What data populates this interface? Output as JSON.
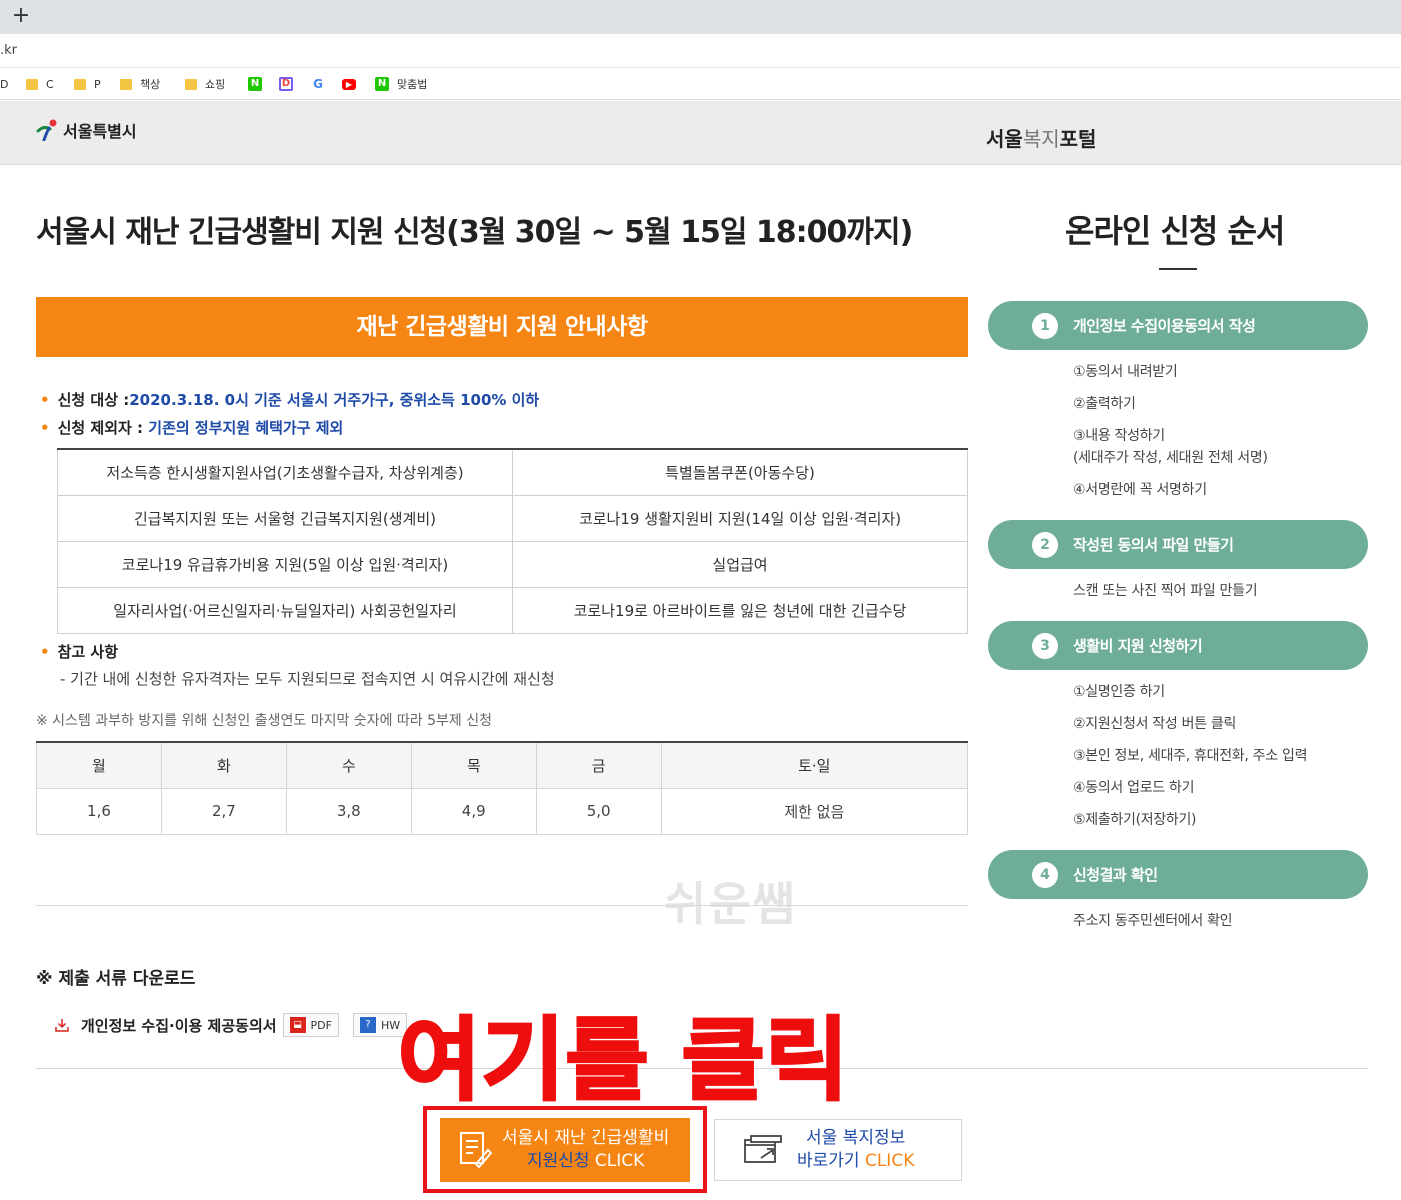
{
  "browser": {
    "new_tab": "+",
    "url": ".kr",
    "bookmarks": [
      {
        "label": "D",
        "type": "text"
      },
      {
        "label": "C",
        "type": "folder"
      },
      {
        "label": "P",
        "type": "folder"
      },
      {
        "label": "책상",
        "type": "folder"
      },
      {
        "label": "쇼핑",
        "type": "folder"
      },
      {
        "label": "N",
        "type": "naver"
      },
      {
        "label": "D",
        "type": "daum"
      },
      {
        "label": "G",
        "type": "google"
      },
      {
        "label": "▶",
        "type": "youtube"
      },
      {
        "label": "맞춤법",
        "type": "naver-label",
        "icon_letter": "N"
      }
    ]
  },
  "header": {
    "city_logo": "서울특별시",
    "portal_logo_a": "서울",
    "portal_logo_b": "복지",
    "portal_logo_c": "포털"
  },
  "main": {
    "title": "서울시 재난 긴급생활비 지원 신청(3월 30일 ~ 5월 15일 18:00까지)",
    "banner": "재난 긴급생활비 지원 안내사항",
    "target_label": "신청 대상 :",
    "target_value": "2020.3.18. 0시 기준 서울시 거주가구, 중위소득 100% 이하",
    "exclude_label": "신청 제외자 :",
    "exclude_value": "기존의 정부지원 혜택가구 제외",
    "exclusions": [
      [
        "저소득층 한시생활지원사업(기초생활수급자, 차상위계층)",
        "특별돌봄쿠폰(아동수당)"
      ],
      [
        "긴급복지지원 또는 서울형 긴급복지지원(생계비)",
        "코로나19 생활지원비 지원(14일 이상 입원·격리자)"
      ],
      [
        "코로나19 유급휴가비용 지원(5일 이상 입원·격리자)",
        "실업급여"
      ],
      [
        "일자리사업(·어르신일자리·뉴딜일자리) 사회공헌일자리",
        "코로나19로 아르바이트를 잃은 청년에 대한 긴급수당"
      ]
    ],
    "ref_label": "참고 사항",
    "ref_note": "- 기간 내에 신청한 유자격자는 모두 지원되므로 접속지연 시 여유시간에 재신청",
    "system_note": "※ 시스템 과부하 방지를 위해 신청인 출생연도 마지막 숫자에 따라 5부제 신청",
    "days_header": [
      "월",
      "화",
      "수",
      "목",
      "금",
      "토·일"
    ],
    "days_values": [
      "1,6",
      "2,7",
      "3,8",
      "4,9",
      "5,0",
      "제한 없음"
    ],
    "watermark": "쉬운쌤",
    "download_title": "※ 제출 서류 다운로드",
    "download_doc": "개인정보 수집·이용 제공동의서",
    "pdf_label": "PDF",
    "hwp_label": "HW",
    "overlay": "여기를 클릭",
    "apply_line1": "서울시 재난 긴급생활비",
    "apply_line2a": "지원신청",
    "apply_line2b": " CLICK",
    "portal_line1": "서울 복지정보",
    "portal_line2a": "바로가기 ",
    "portal_line2b": "CLICK"
  },
  "side": {
    "title": "온라인 신청 순서",
    "steps": [
      {
        "num": "1",
        "label": "개인정보 수집이용동의서 작성"
      },
      {
        "num": "2",
        "label": "작성된 동의서 파일 만들기"
      },
      {
        "num": "3",
        "label": "생활비 지원 신청하기"
      },
      {
        "num": "4",
        "label": "신청결과 확인"
      }
    ],
    "step1_items": [
      "①동의서 내려받기",
      "②출력하기",
      "③내용 작성하기",
      "(세대주가 작성, 세대원 전체 서명)",
      "④서명란에 꼭 서명하기"
    ],
    "step2_items": [
      "스캔 또는 사진 찍어 파일 만들기"
    ],
    "step3_items": [
      "①실명인증 하기",
      "②지원신청서 작성 버튼 클릭",
      "③본인 정보, 세대주, 휴대전화, 주소 입력",
      "④동의서 업로드 하기",
      "⑤제출하기(저장하기)"
    ],
    "step4_items": [
      "주소지 동주민센터에서 확인"
    ]
  },
  "colors": {
    "accent_orange": "#f68614",
    "step_green": "#6fae96",
    "link_blue": "#1e4aa8",
    "overlay_red": "#ee0e0e"
  }
}
